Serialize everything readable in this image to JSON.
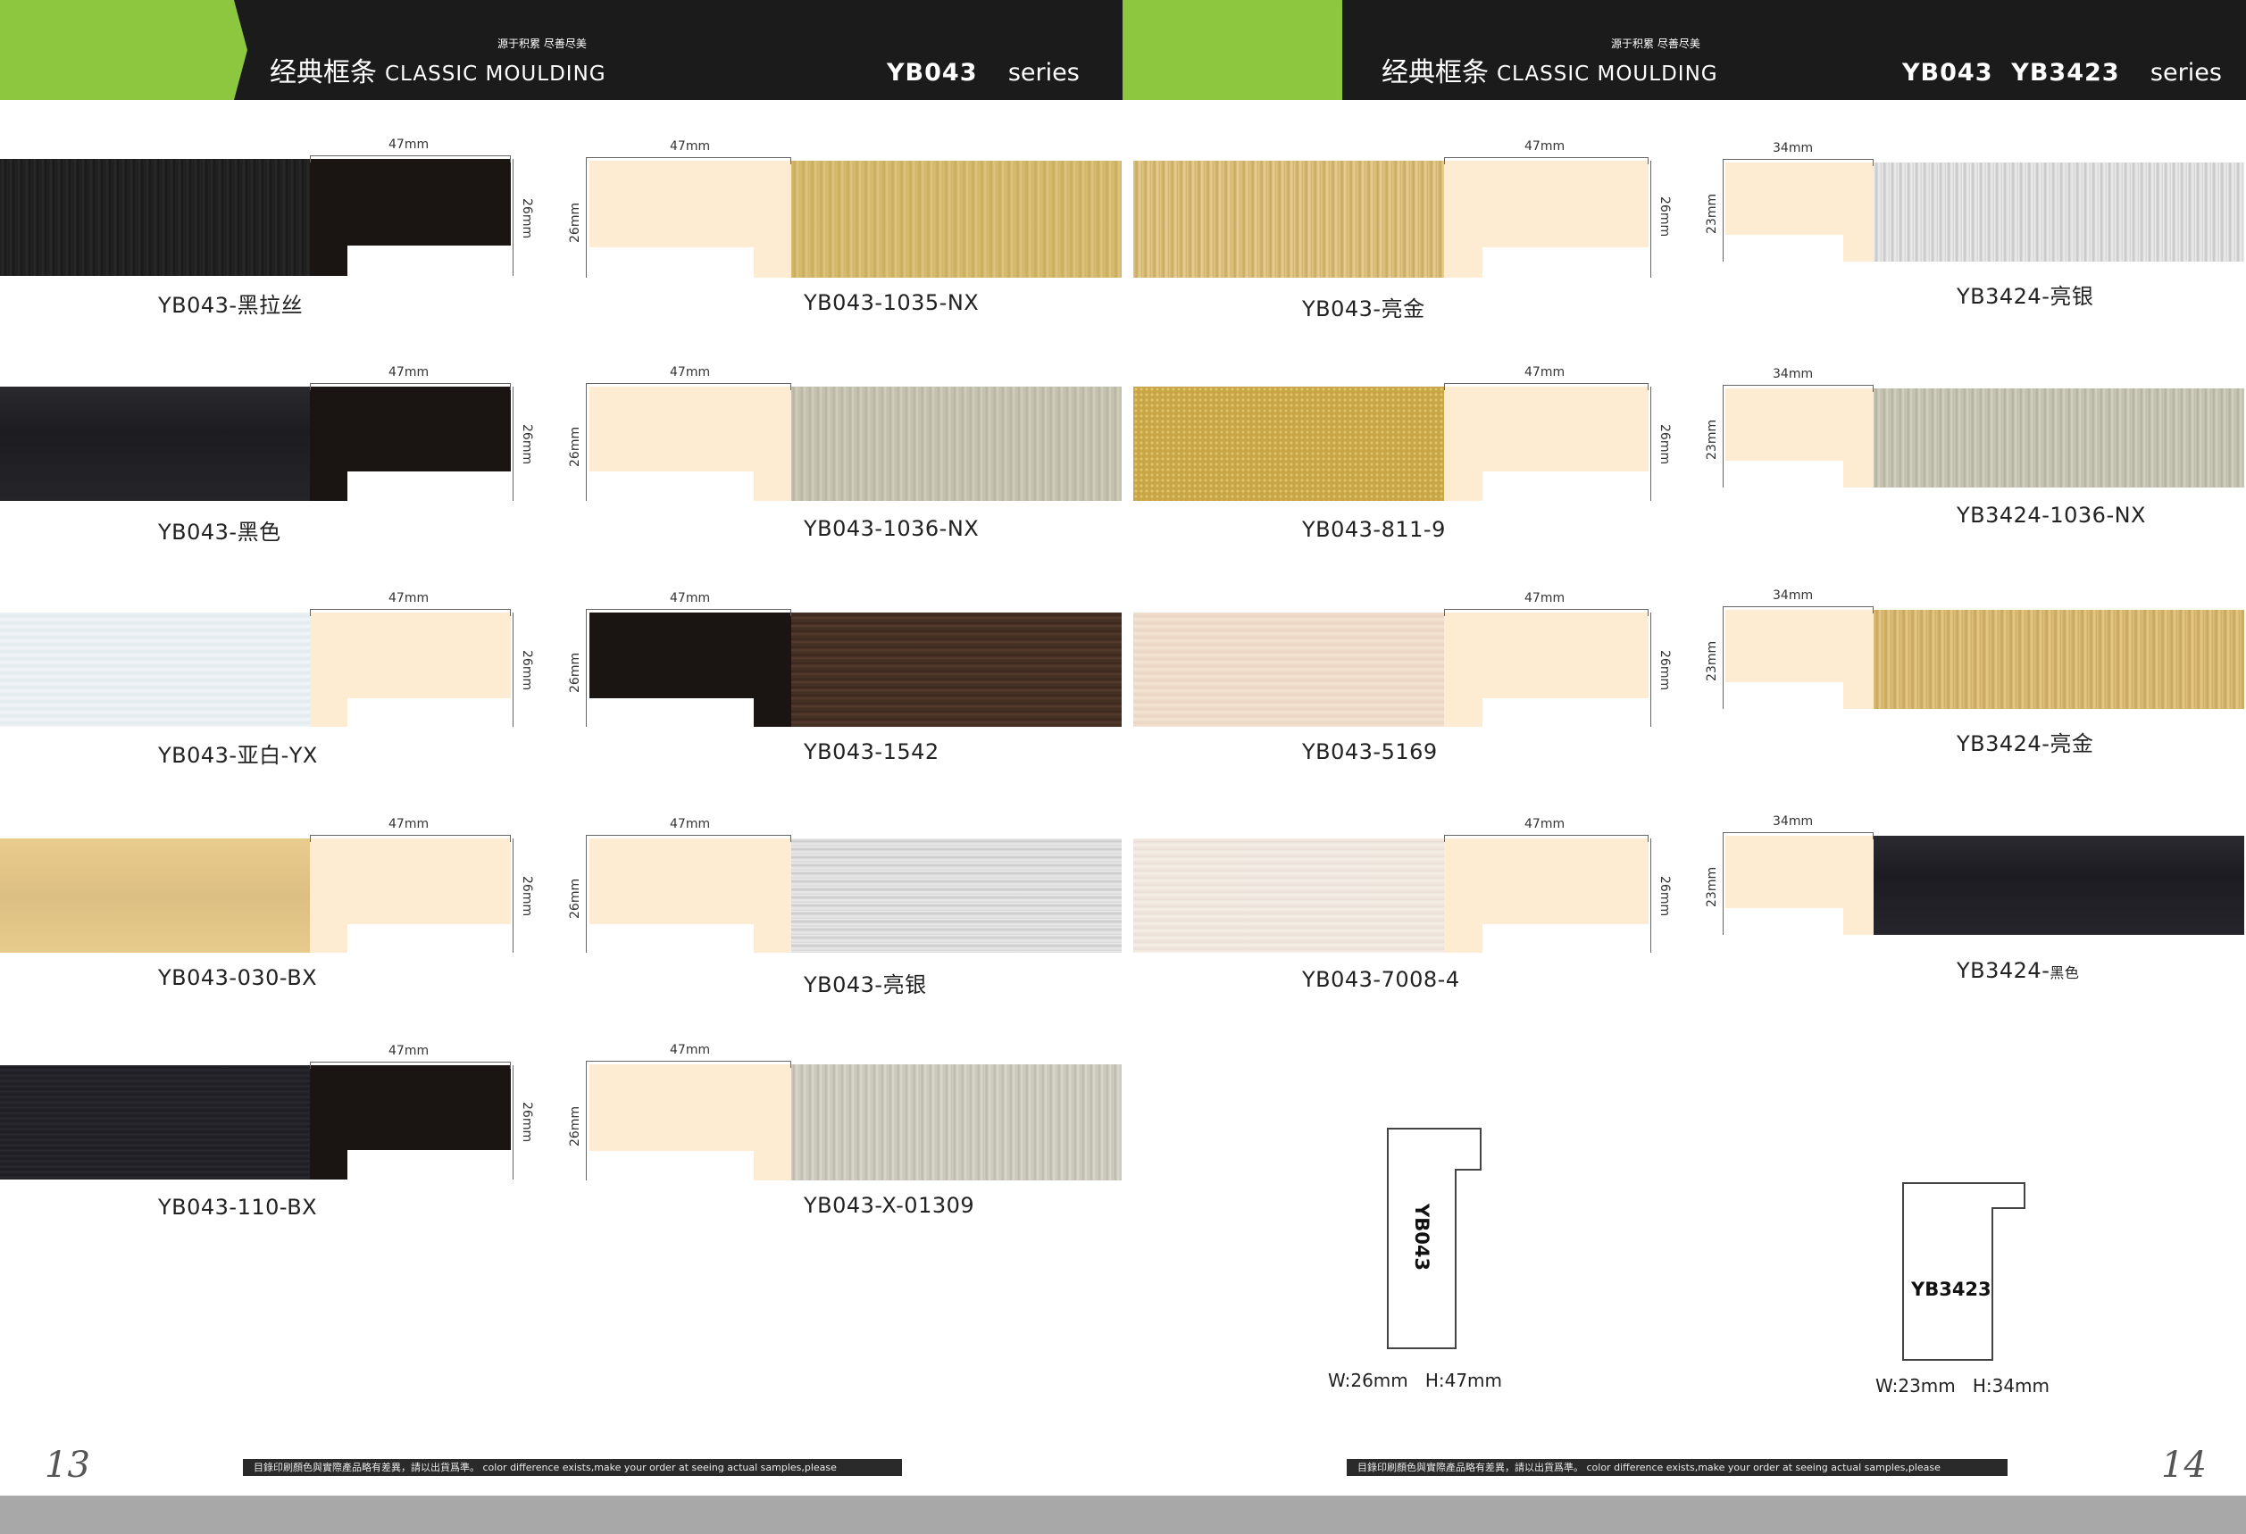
{
  "colors": {
    "green": "#8dc63f",
    "header": "#1b1b1b",
    "profile": "#fdebd2",
    "black_profile": "#1a1412"
  },
  "left": {
    "slogan": "源于积累 尽善尽美",
    "title_cn": "经典框条",
    "title_en": "CLASSIC MOULDING",
    "series_code": "YB043",
    "series_word": "series",
    "page_number": "13",
    "footnote": "目錄印刷顏色與實際產品略有差異，請以出貨爲準。 color difference exists,make your order at seeing actual samples,please"
  },
  "right": {
    "slogan": "源于积累 尽善尽美",
    "title_cn": "经典框条",
    "title_en": "CLASSIC MOULDING",
    "series_code": "YB043  YB3423",
    "series_word": "series",
    "page_number": "14",
    "footnote": "目錄印刷顏色與實際產品略有差異，請以出貨爲準。 color difference exists,make your order at seeing actual samples,please"
  },
  "dims": {
    "w47": "47mm",
    "h26": "26mm",
    "w34": "34mm",
    "h23": "23mm"
  },
  "products": {
    "c1": [
      "YB043-黑拉丝",
      "YB043-黑色",
      "YB043-亚白-YX",
      "YB043-030-BX",
      "YB043-110-BX"
    ],
    "c2": [
      "YB043-1035-NX",
      "YB043-1036-NX",
      "YB043-1542",
      "YB043-亮银",
      "YB043-X-01309"
    ],
    "c3": [
      "YB043-亮金",
      "YB043-811-9",
      "YB043-5169",
      "YB043-7008-4"
    ],
    "c4": [
      "YB3424-亮银",
      "YB3424-1036-NX",
      "YB3424-亮金"
    ],
    "c4_last_prefix": "YB3424-",
    "c4_last_suffix": "黑色"
  },
  "outlines": {
    "a_label": "YB043",
    "a_dims": "W:26mm   H:47mm",
    "b_label": "YB3423",
    "b_dims": "W:23mm   H:34mm"
  }
}
